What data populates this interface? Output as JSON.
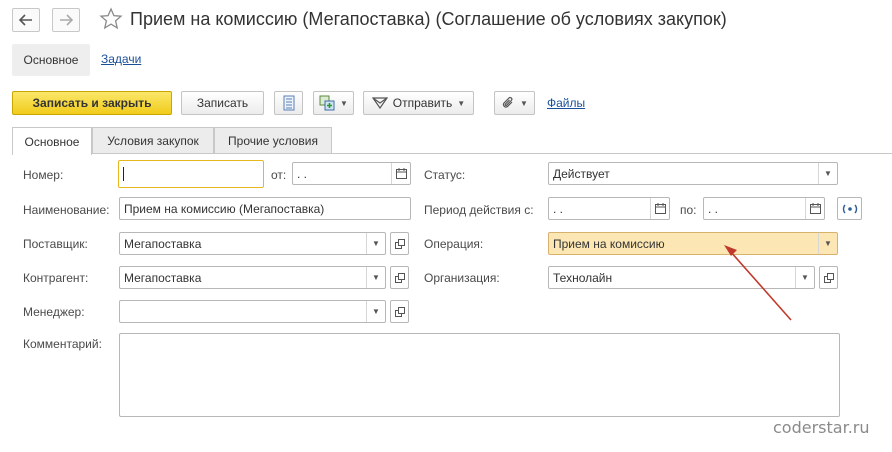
{
  "window": {
    "title": "Прием на комиссию (Мегапоставка) (Соглашение об условиях закупок)"
  },
  "sections": {
    "main": "Основное",
    "tasks": "Задачи"
  },
  "toolbar": {
    "save_close": "Записать и закрыть",
    "save": "Записать",
    "send": "Отправить",
    "files": "Файлы"
  },
  "tabs": [
    {
      "label": "Основное",
      "active": true
    },
    {
      "label": "Условия закупок",
      "active": false
    },
    {
      "label": "Прочие условия",
      "active": false
    }
  ],
  "form": {
    "number_label": "Номер:",
    "number_value": "",
    "from_label": "от:",
    "date_value": " .  .",
    "name_label": "Наименование:",
    "name_value": "Прием на комиссию (Мегапоставка)",
    "supplier_label": "Поставщик:",
    "supplier_value": "Мегапоставка",
    "counterparty_label": "Контрагент:",
    "counterparty_value": "Мегапоставка",
    "manager_label": "Менеджер:",
    "manager_value": "",
    "comment_label": "Комментарий:",
    "status_label": "Статус:",
    "status_value": "Действует",
    "period_label": "Период действия с:",
    "period_from_value": " .  .",
    "period_to_label": "по:",
    "period_to_value": " .  .",
    "operation_label": "Операция:",
    "operation_value": "Прием на комиссию",
    "organization_label": "Организация:",
    "organization_value": "Технолайн"
  },
  "watermark": "coderstar.ru",
  "colors": {
    "primary_button": "#f1cc1b",
    "highlight_field": "#fce7b4",
    "link": "#1a4f9c",
    "annotation_arrow": "#c0392b"
  }
}
